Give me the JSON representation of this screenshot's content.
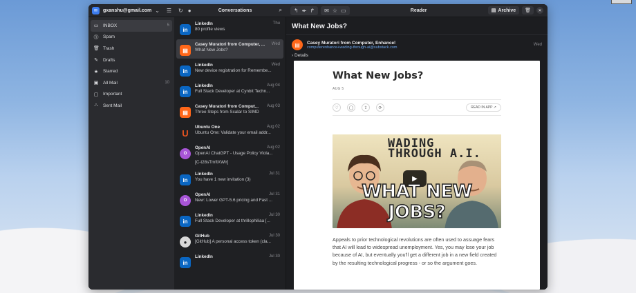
{
  "titlebar": {
    "account": "gxanshu@gmail.com",
    "conversations_title": "Conversations",
    "reader_title": "Reader",
    "archive_label": "Archive"
  },
  "sidebar": {
    "items": [
      {
        "label": "INBOX",
        "count": "5",
        "icon": "inbox-icon",
        "glyph": "▭"
      },
      {
        "label": "Spam",
        "count": "",
        "icon": "spam-icon",
        "glyph": "⓵"
      },
      {
        "label": "Trash",
        "count": "",
        "icon": "trash-icon",
        "glyph": "🗑"
      },
      {
        "label": "Drafts",
        "count": "",
        "icon": "drafts-icon",
        "glyph": "✎"
      },
      {
        "label": "Starred",
        "count": "",
        "icon": "star-icon",
        "glyph": "★"
      },
      {
        "label": "All Mail",
        "count": "10",
        "icon": "all-mail-icon",
        "glyph": "▣"
      },
      {
        "label": "Important",
        "count": "",
        "icon": "important-icon",
        "glyph": "▢"
      },
      {
        "label": "Sent Mail",
        "count": "",
        "icon": "sent-mail-icon",
        "glyph": "⛬"
      }
    ]
  },
  "conversations": [
    {
      "sender": "LinkedIn",
      "date": "Thu",
      "subject": "80 profile views",
      "avatar": "linkedin"
    },
    {
      "sender": "Casey Muratori from Computer, ...",
      "date": "Wed",
      "subject": "What New Jobs?",
      "avatar": "substack",
      "selected": true
    },
    {
      "sender": "LinkedIn",
      "date": "Wed",
      "subject": "New device registration for Remembe...",
      "avatar": "linkedin"
    },
    {
      "sender": "LinkedIn",
      "date": "Aug 04",
      "subject": "Full Stack Developer at Cynbit Techn...",
      "avatar": "linkedin"
    },
    {
      "sender": "Casey Muratori from Comput...",
      "date": "Aug 03",
      "subject": "Three Steps from Scalar to SIMD",
      "avatar": "substack"
    },
    {
      "sender": "Ubuntu One",
      "date": "Aug 02",
      "subject": "Ubuntu One: Validate your email addr...",
      "avatar": "ubuntu"
    },
    {
      "sender": "OpenAI",
      "date": "Aug 02",
      "subject": "OpenAI ChatGPT - Usage Policy Viola...",
      "extra": "[C-t28sTmftXWlr]",
      "avatar": "openai"
    },
    {
      "sender": "LinkedIn",
      "date": "Jul 31",
      "subject": "You have 1 new invitation (3)",
      "avatar": "linkedin"
    },
    {
      "sender": "OpenAI",
      "date": "Jul 31",
      "subject": "New: Lower GPT-5.6 pricing and Fast ...",
      "avatar": "openai"
    },
    {
      "sender": "LinkedIn",
      "date": "Jul 30",
      "subject": "Full Stack Developer at thrillophiliaa [...",
      "avatar": "linkedin"
    },
    {
      "sender": "GitHub",
      "date": "Jul 30",
      "subject": "[GitHub] A personal access token (cla...",
      "avatar": "github"
    },
    {
      "sender": "LinkedIn",
      "date": "Jul 30",
      "subject": "",
      "avatar": "linkedin"
    }
  ],
  "reader": {
    "subject": "What New Jobs?",
    "from_name": "Casey Muratori from Computer, Enhance!",
    "from_email": "computerenhance+wading-through-ai@substack.com",
    "date": "Wed",
    "details_label": "Details",
    "post": {
      "title": "What New Jobs?",
      "date": "AUG 5",
      "read_in_app": "READ IN APP ↗",
      "thumbnail_headline": "WADING THROUGH A.I.",
      "thumbnail_caption": "WHAT NEW JOBS?",
      "body": "Appeals to prior technological revolutions are often used to assuage fears that AI will lead to widespread unemployment. Yes, you may lose your job because of AI, but eventually you'll get a different job in a new field created by the resulting technological progress - or so the argument goes."
    }
  },
  "colors": {
    "accent": "#3d7df0",
    "linkedin": "#0a66c2",
    "substack": "#ff6719",
    "openai": "#a855d7"
  }
}
